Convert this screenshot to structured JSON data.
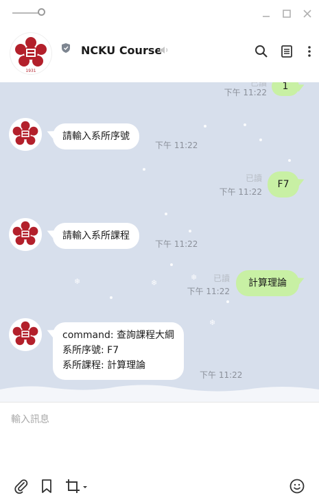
{
  "header": {
    "title": "NCKU Course",
    "avatar_year": "1931"
  },
  "messages": [
    {
      "side": "out",
      "text": "1",
      "status": "已讀",
      "time": "下午 11:22"
    },
    {
      "side": "in",
      "text": "請輸入系所序號",
      "time": "下午 11:22"
    },
    {
      "side": "out",
      "text": "F7",
      "status": "已讀",
      "time": "下午 11:22"
    },
    {
      "side": "in",
      "text": "請輸入系所課程",
      "time": "下午 11:22"
    },
    {
      "side": "out",
      "text": "計算理論",
      "status": "已讀",
      "time": "下午 11:22"
    },
    {
      "side": "in",
      "lines": [
        "command: 查詢課程大綱",
        "系所序號: F7",
        "系所課程: 計算理論"
      ],
      "time": "下午 11:22"
    }
  ],
  "composer": {
    "placeholder": "輸入訊息"
  },
  "colors": {
    "chat_bg": "#d7dfec",
    "outgoing_bubble": "#c8f0a4",
    "incoming_bubble": "#ffffff",
    "logo_red": "#b3202b"
  }
}
